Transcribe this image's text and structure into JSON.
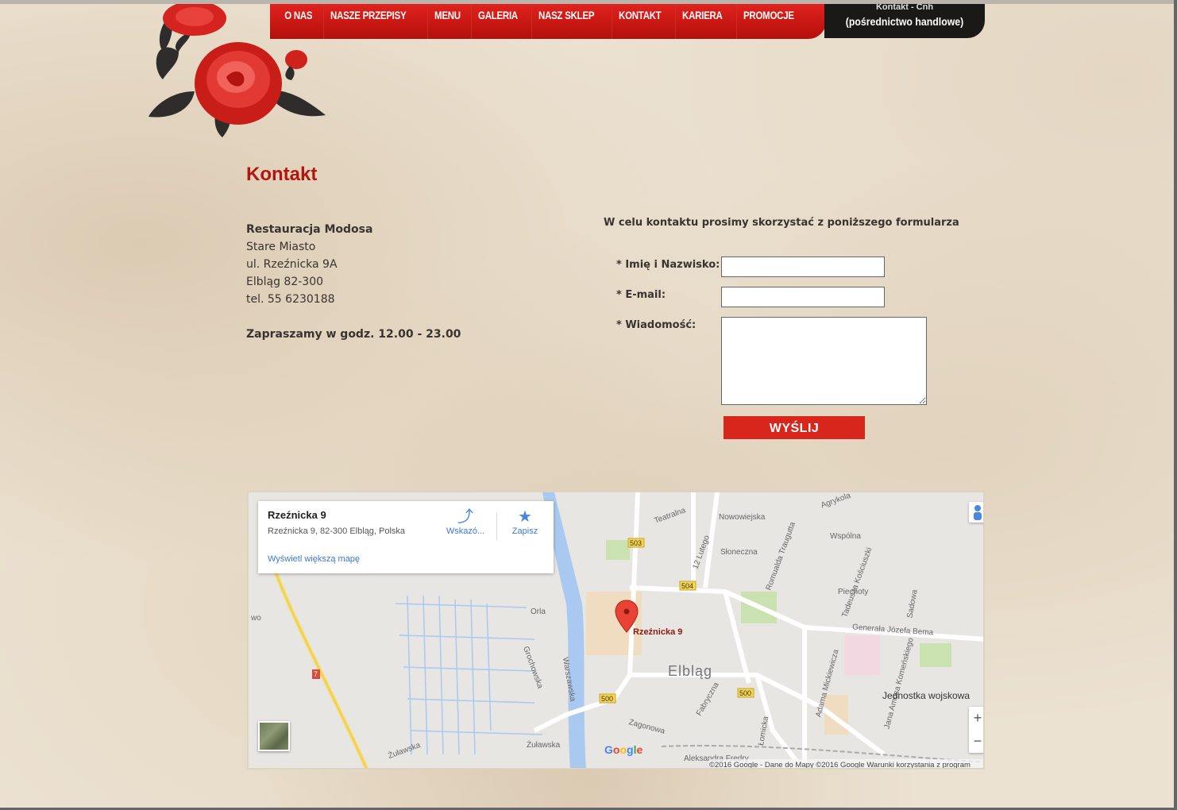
{
  "nav": {
    "items": [
      "O NAS",
      "NASZE PRZEPISY",
      "MENU",
      "GALERIA",
      "NASZ SKLEP",
      "KONTAKT",
      "KARIERA",
      "PROMOCJE"
    ],
    "right_small": "Kontakt - Cnh",
    "right_big": "(pośrednictwo handlowe)"
  },
  "page": {
    "title": "Kontakt"
  },
  "address": {
    "name": "Restauracja Modosa",
    "line1": "Stare Miasto",
    "line2": "ul. Rzeźnicka 9A",
    "line3": "Elbląg 82-300",
    "phone": "tel. 55 6230188",
    "hours": "Zapraszamy w godz. 12.00 - 23.00"
  },
  "form": {
    "intro": "W celu kontaktu prosimy skorzystać z poniższego formularza",
    "name_label": "* Imię i Nazwisko:",
    "email_label": "* E-mail:",
    "message_label": "* Wiadomość:",
    "name_value": "",
    "email_value": "",
    "message_value": "",
    "submit": "WYŚLIJ",
    "accent": "#d8261d"
  },
  "map": {
    "card_title": "Rzeźnicka 9",
    "card_address": "Rzeźnicka 9, 82-300 Elbląg, Polska",
    "directions": "Wskazó...",
    "save": "Zapisz",
    "larger_map": "Wyświetl większą mapę",
    "pin_label": "Rzeźnicka 9",
    "city": "Elbląg",
    "copyright": "©2016 Google - Dane do Mapy ©2016 Google   Warunki korzystania z program",
    "zoom_in": "+",
    "zoom_out": "−",
    "labels": {
      "teatralna": "Teatralna",
      "nowowiejska": "Nowowiejska",
      "agrykola": "Agrykola",
      "slonecznа": "Słoneczna",
      "lutego": "12 Lutego",
      "traugutta": "Romualda Traugutta",
      "wspolna": "Wspólna",
      "kosciuszki": "Tadeusza Kościuszki",
      "piechoty": "Piechoty",
      "sadowa": "Sadowa",
      "bema": "Generała Józefa Bema",
      "orla": "Orla",
      "grochowska": "Grochowska",
      "warszawska": "Warszawska",
      "mickiewicza": "Adama Mickiewicza",
      "komenskiego": "Jana Amosa Komeńskiego",
      "jednostka": "Jednostka wojskowa",
      "fabryczna": "Fabryczna",
      "zagonowa": "Zagonowa",
      "lomiczna": "Łomicka",
      "zulawska1": "Żuławska",
      "zulawska2": "Żuławska",
      "fredry": "Aleksandra Fredry",
      "wo": "wo",
      "rd503": "503",
      "rd504": "504",
      "rd500a": "500",
      "rd500b": "500",
      "rd7": "7",
      "google": [
        "G",
        "o",
        "o",
        "g",
        "l",
        "e"
      ]
    }
  }
}
